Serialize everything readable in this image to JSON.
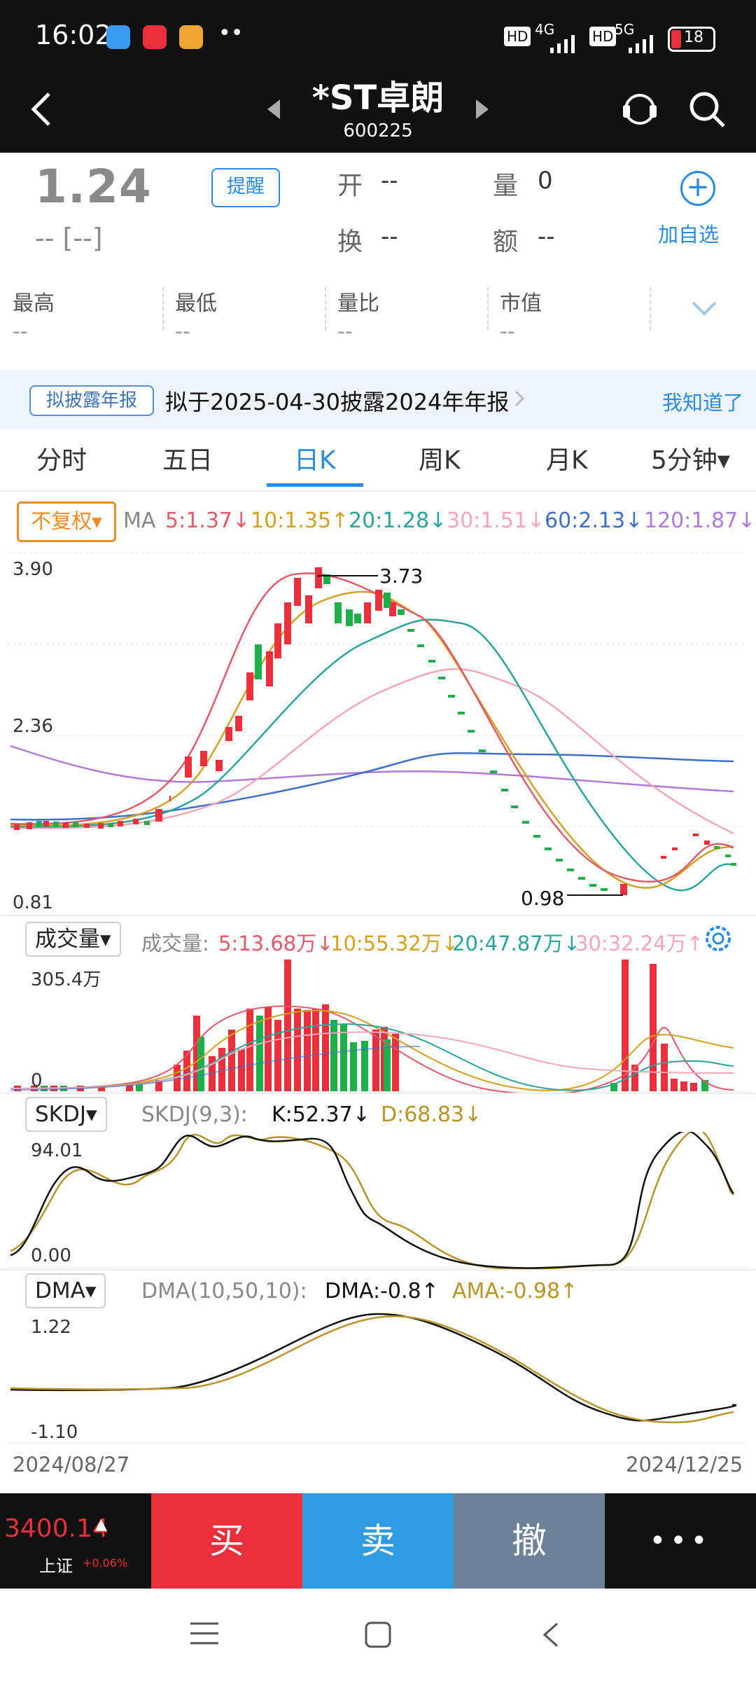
{
  "status": {
    "time": "16:02",
    "dots": "••",
    "net1": "4G",
    "net2": "5G",
    "hd": "HD",
    "battery": "18"
  },
  "header": {
    "name": "*ST卓朗",
    "code": "600225"
  },
  "quote": {
    "price": "1.24",
    "change": "-- [--]",
    "remind": "提醒",
    "open_label": "开",
    "open_val": "--",
    "vol_label": "量",
    "vol_val": "0",
    "turn_label": "换",
    "turn_val": "--",
    "amt_label": "额",
    "amt_val": "--",
    "add_fav": "加自选"
  },
  "stats": [
    {
      "label": "最高",
      "value": "--"
    },
    {
      "label": "最低",
      "value": "--"
    },
    {
      "label": "量比",
      "value": "--"
    },
    {
      "label": "市值",
      "value": "--"
    }
  ],
  "notice": {
    "tag": "拟披露年报",
    "text": "拟于2025-04-30披露2024年年报",
    "ok": "我知道了"
  },
  "tabs": [
    "分时",
    "五日",
    "日K",
    "周K",
    "月K",
    "5分钟▾"
  ],
  "active_tab": "日K",
  "ma_bar": {
    "fq": "不复权",
    "ma": "MA",
    "items": [
      {
        "text": "5:1.37↓",
        "color": "#e05a6a"
      },
      {
        "text": "10:1.35↑",
        "color": "#d4a020"
      },
      {
        "text": "20:1.28↓",
        "color": "#2aa39a"
      },
      {
        "text": "30:1.51↓",
        "color": "#f4a6b8"
      },
      {
        "text": "60:2.13↓",
        "color": "#3f6fc8"
      },
      {
        "text": "120:1.87↓",
        "color": "#b07ad8"
      }
    ]
  },
  "kline": {
    "y_top": "3.90",
    "y_mid": "2.36",
    "y_bot": "0.81",
    "high_label": "3.73",
    "low_label": "0.98"
  },
  "volume": {
    "btn": "成交量",
    "label": "成交量:",
    "items": [
      {
        "text": "5:13.68万↓",
        "color": "#e05a6a"
      },
      {
        "text": "10:55.32万↓",
        "color": "#d4a020"
      },
      {
        "text": "20:47.87万↓",
        "color": "#2aa39a"
      },
      {
        "text": "30:32.24万↑",
        "color": "#f4a6b8"
      }
    ],
    "y_top": "305.4万",
    "y_bot": "0"
  },
  "skdj": {
    "btn": "SKDJ",
    "label": "SKDJ(9,3):",
    "k": "K:52.37↓",
    "d": "D:68.83↓",
    "y_top": "94.01",
    "y_bot": "0.00"
  },
  "dma": {
    "btn": "DMA",
    "label": "DMA(10,50,10):",
    "dma": "DMA:-0.8↑",
    "ama": "AMA:-0.98↑",
    "y_top": "1.22",
    "y_bot": "-1.10"
  },
  "dates": {
    "start": "2024/08/27",
    "end": "2024/12/25"
  },
  "index": {
    "value": "3400.14",
    "arrow": "▲",
    "name": "上证",
    "pct": "+0.06%"
  },
  "trade": {
    "buy": "买",
    "sell": "卖",
    "cancel": "撤",
    "more": "•••"
  },
  "colors": {
    "up": "#e8303c",
    "down": "#1fae4a",
    "accent": "#2a8be0",
    "buy": "#e8303c",
    "sell": "#2f9be3",
    "cancel": "#6e8399"
  }
}
